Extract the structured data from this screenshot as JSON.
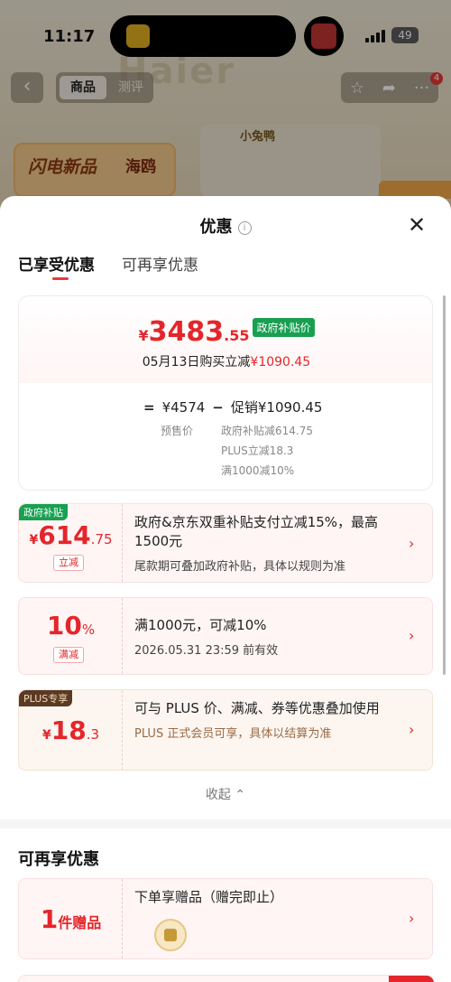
{
  "status": {
    "time": "11:17",
    "battery": "49"
  },
  "nav": {
    "tab_product": "商品",
    "tab_review": "测评",
    "badge": "4"
  },
  "background": {
    "brand1": "Haier",
    "brand2": "",
    "promo1_a": "闪电新品",
    "promo1_b": "海鸥",
    "promo2": "小兔鸭"
  },
  "sheet": {
    "title": "优惠",
    "info_icon": "i",
    "tabs": [
      "已享受优惠",
      "可再享优惠"
    ]
  },
  "price_card": {
    "currency": "¥",
    "price_int": "3483",
    "price_dec": ".55",
    "gov_tag": "政府补贴价",
    "sub_prefix": "05月13日购买立减",
    "sub_amount": "¥1090.45",
    "eq": "=",
    "presale": "¥4574",
    "minus": "−",
    "promo_total": "促销¥1090.45",
    "presale_label": "预售价",
    "breakdown": [
      "政府补贴减614.75",
      "PLUS立减18.3",
      "满1000减10%"
    ]
  },
  "promos": [
    {
      "corner": "政府补贴",
      "currency": "¥",
      "int": "614",
      "dec": ".75",
      "tag": "立减",
      "title": "政府&京东双重补贴支付立减15%，最高1500元",
      "sub": "尾款期可叠加政府补贴，具体以规则为准"
    },
    {
      "corner": "",
      "currency": "",
      "int": "10",
      "dec": "%",
      "tag": "满减",
      "title": "满1000元，可减10%",
      "sub": "2026.05.31 23:59 前有效"
    },
    {
      "corner": "PLUS专享",
      "currency": "¥",
      "int": "18",
      "dec": ".3",
      "tag": "",
      "title": "可与 PLUS 价、满减、券等优惠叠加使用",
      "sub": "PLUS 正式会员可享，具体以结算为准"
    }
  ],
  "collapse_label": "收起 ⌃",
  "section2": {
    "title": "可再享优惠",
    "gift_count": "1",
    "gift_unit": "件赠品",
    "gift_title": "下单享赠品（赠完即止）"
  },
  "colors": {
    "accent_red": "#e4262b",
    "gov_green": "#18a050",
    "plus_brown": "#5a3a25"
  }
}
